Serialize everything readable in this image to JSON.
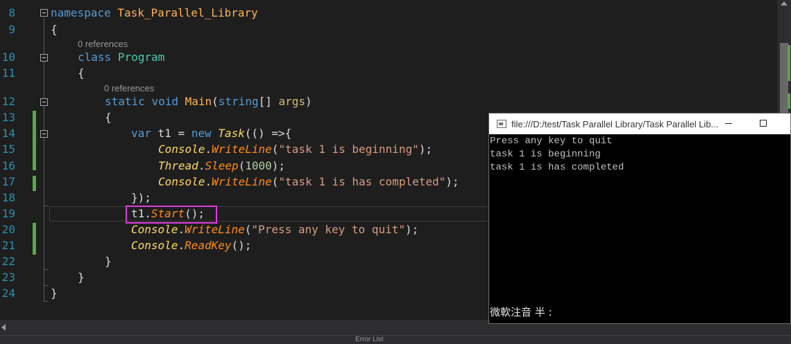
{
  "editor": {
    "line_numbers": [
      "8",
      "9",
      "10",
      "11",
      "12",
      "13",
      "14",
      "15",
      "16",
      "17",
      "18",
      "19",
      "20",
      "21",
      "22",
      "23",
      "24"
    ],
    "reference_hint": "0 references",
    "lines": {
      "l8": {
        "kw": "namespace",
        "name": "Task_Parallel_Library"
      },
      "l9": {
        "text": "{"
      },
      "l10": {
        "kw": "class",
        "name": "Program"
      },
      "l11": {
        "text": "{"
      },
      "l12": {
        "kw1": "static",
        "kw2": "void",
        "method": "Main",
        "p1": "(",
        "type": "string",
        "p2": "[] ",
        "arg": "args",
        "p3": ")"
      },
      "l13": {
        "text": "{"
      },
      "l14": {
        "kw1": "var",
        "p1": " t1 = ",
        "kw2": "new",
        "p2": " ",
        "cls": "Task",
        "p3": "(() =>{"
      },
      "l15": {
        "cls": "Console",
        "dot": ".",
        "method": "WriteLine",
        "p1": "(",
        "str": "\"task 1 is beginning\"",
        "p2": ");"
      },
      "l16": {
        "cls": "Thread",
        "dot": ".",
        "method": "Sleep",
        "p1": "(",
        "num": "1000",
        "p2": ");"
      },
      "l17": {
        "cls": "Console",
        "dot": ".",
        "method": "WriteLine",
        "p1": "(",
        "str": "\"task 1 is has completed\"",
        "p2": ");"
      },
      "l18": {
        "text": "});"
      },
      "l19": {
        "obj": "t1",
        "dot": ".",
        "method": "Start",
        "p1": "();"
      },
      "l20": {
        "cls": "Console",
        "dot": ".",
        "method": "WriteLine",
        "p1": "(",
        "str": "\"Press any key to quit\"",
        "p2": ");"
      },
      "l21": {
        "cls": "Console",
        "dot": ".",
        "method": "ReadKey",
        "p1": "();"
      },
      "l22": {
        "text": "}"
      },
      "l23": {
        "text": "}"
      },
      "l24": {
        "text": "}"
      }
    }
  },
  "console_window": {
    "title": "file:///D:/test/Task Parallel Library/Task Parallel Lib...",
    "output": [
      "Press any key to quit",
      "task 1 is beginning",
      "task 1 is has completed"
    ],
    "ime_status": "微軟注音 半 :"
  },
  "status_strip": {
    "panel_label": "Error List"
  },
  "colors": {
    "background": "#1e1e1e",
    "keyword": "#569cd6",
    "type": "#4ec9b0",
    "string": "#d69d85",
    "number": "#b5cea8",
    "highlight_box": "#e03ce0",
    "change_bar": "#57a64a"
  },
  "icons": [
    "console-window-icon",
    "minimize-icon",
    "maximize-icon",
    "scroll-up-arrow-icon",
    "scroll-left-arrow-icon",
    "collapse-icon"
  ]
}
